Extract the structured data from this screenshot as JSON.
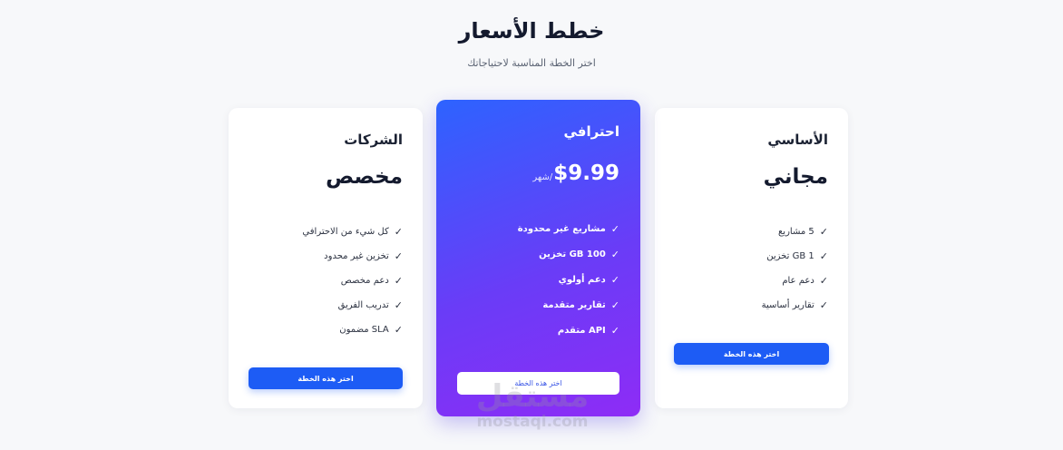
{
  "header": {
    "title": "خطط الأسعار",
    "subtitle": "اختر الخطة المناسبة لاحتياجاتك"
  },
  "plans": [
    {
      "name": "الأساسي",
      "price": "مجاني",
      "features": [
        "5 مشاريع",
        "1 GB تخزين",
        "دعم عام",
        "تقارير أساسية"
      ],
      "button": "اختر هذه الخطة"
    },
    {
      "name": "احترافي",
      "price": "$9.99",
      "period": "/شهر",
      "features": [
        "مشاريع غير محدودة",
        "100 GB تخزين",
        "دعم أولوي",
        "تقارير متقدمة",
        "API متقدم"
      ],
      "button": "اختر هذه الخطة"
    },
    {
      "name": "الشركات",
      "price": "مخصص",
      "features": [
        "كل شيء من الاحترافي",
        "تخزين غير محدود",
        "دعم مخصص",
        "تدريب الفريق",
        "SLA مضمون"
      ],
      "button": "اختر هذه الخطة"
    }
  ],
  "check_glyph": "✓",
  "colors": {
    "accent": "#1d5cf5",
    "gradient_start": "#2d63ff",
    "gradient_end": "#8e2cf6",
    "background": "#f7f8fa"
  },
  "watermark": {
    "arabic": "مستقل",
    "latin": "mostaqi.com"
  }
}
